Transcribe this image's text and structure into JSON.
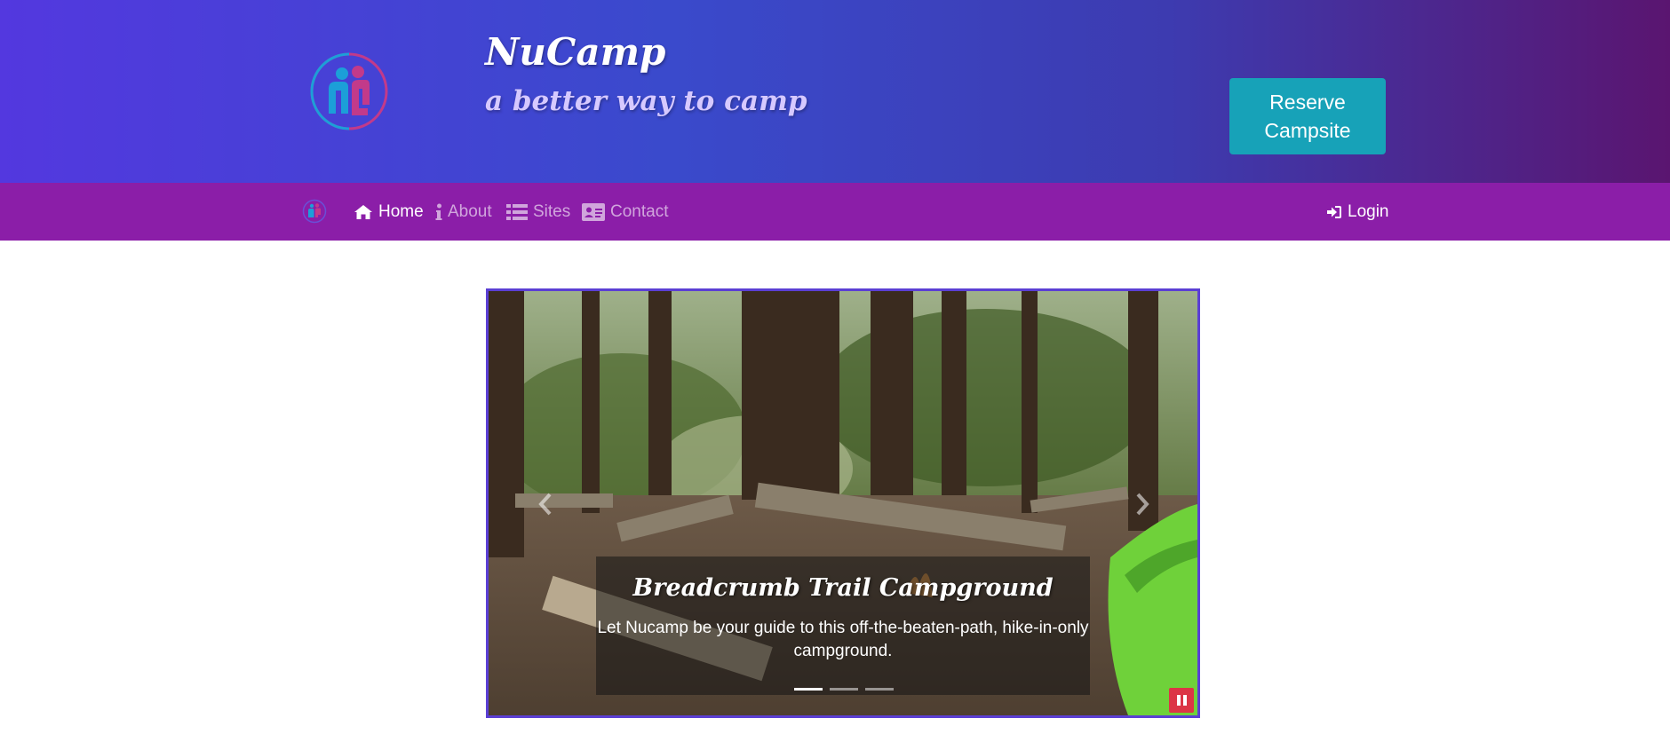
{
  "header": {
    "title": "NuCamp",
    "tagline": "a better way to camp",
    "reserve_button": "Reserve Campsite",
    "logo_icon": "nucamp-logo-icon"
  },
  "nav": {
    "items": [
      {
        "label": "Home",
        "icon": "home-icon",
        "active": true
      },
      {
        "label": "About",
        "icon": "info-icon",
        "active": false
      },
      {
        "label": "Sites",
        "icon": "list-icon",
        "active": false
      },
      {
        "label": "Contact",
        "icon": "address-card-icon",
        "active": false
      }
    ],
    "login": {
      "label": "Login",
      "icon": "sign-in-icon"
    }
  },
  "carousel": {
    "caption_title": "Breadcrumb Trail Campground",
    "caption_text": "Let Nucamp be your guide to this off-the-beaten-path, hike-in-only campground.",
    "slides_count": 3,
    "active_slide": 1,
    "pause_icon": "pause-icon"
  },
  "colors": {
    "header_start": "#5338df",
    "header_end": "#5a1570",
    "navbar": "#8b1ea8",
    "reserve_button": "#17a2b8",
    "carousel_border": "#5b3fd4",
    "pause_button": "#dc3545"
  }
}
